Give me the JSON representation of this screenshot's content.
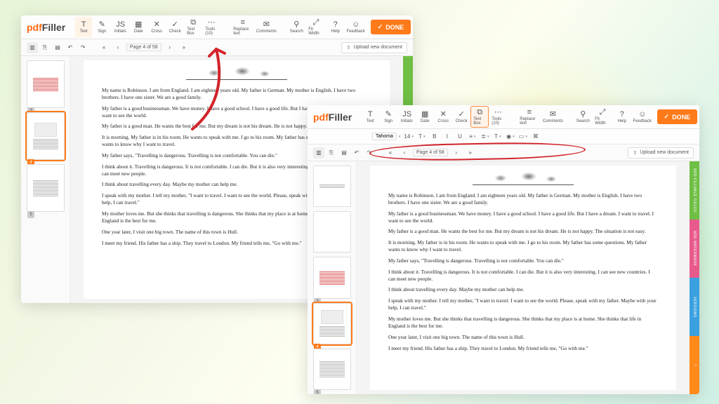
{
  "brand": {
    "pdf": "pdf",
    "filler": "Filler"
  },
  "done_label": "DONE",
  "upload_label": "Upload new document",
  "page_indicator": "Page 4 of 58",
  "second_page_indicator": "Page 4 of 58",
  "toolbar": [
    {
      "id": "text",
      "label": "Text",
      "glyph": "T"
    },
    {
      "id": "sign",
      "label": "Sign",
      "glyph": "✎"
    },
    {
      "id": "initials",
      "label": "Initials",
      "glyph": "JS"
    },
    {
      "id": "date",
      "label": "Date",
      "glyph": "▦"
    },
    {
      "id": "cross",
      "label": "Cross",
      "glyph": "✕"
    },
    {
      "id": "check",
      "label": "Check",
      "glyph": "✓"
    },
    {
      "id": "textbox",
      "label": "Text Box",
      "glyph": "⧉"
    },
    {
      "id": "tools",
      "label": "Tools (10)",
      "glyph": "⋯"
    }
  ],
  "toolbar_mid": [
    {
      "id": "replace",
      "label": "Replace text",
      "glyph": "≡"
    },
    {
      "id": "comments",
      "label": "Comments",
      "glyph": "✉"
    }
  ],
  "toolbar_right": [
    {
      "id": "search",
      "label": "Search",
      "glyph": "⚲"
    },
    {
      "id": "fitwidth",
      "label": "Fit Width",
      "glyph": "⤢"
    },
    {
      "id": "help",
      "label": "Help",
      "glyph": "?"
    },
    {
      "id": "feedback",
      "label": "Feedback",
      "glyph": "☺"
    }
  ],
  "second_quick": [
    {
      "id": "sheet",
      "glyph": "▥"
    },
    {
      "id": "copy",
      "glyph": "⎘"
    },
    {
      "id": "pages",
      "glyph": "▤"
    },
    {
      "id": "undo",
      "glyph": "↶"
    },
    {
      "id": "redo",
      "glyph": "↷"
    }
  ],
  "format_bar": {
    "font_name": "Tahoma",
    "font_size": "14",
    "items": [
      {
        "id": "fontsize",
        "glyph": "14",
        "drop": true
      },
      {
        "id": "lineheight",
        "glyph": "T",
        "drop": true
      },
      {
        "id": "bold",
        "glyph": "B"
      },
      {
        "id": "italic",
        "glyph": "I"
      },
      {
        "id": "underline",
        "glyph": "U"
      },
      {
        "id": "align",
        "glyph": "≡",
        "drop": true
      },
      {
        "id": "bullets",
        "glyph": "≣",
        "drop": true
      },
      {
        "id": "case",
        "glyph": "T",
        "drop": true
      },
      {
        "id": "color",
        "glyph": "◉",
        "drop": true
      },
      {
        "id": "bg",
        "glyph": "▭",
        "drop": true
      },
      {
        "id": "link",
        "glyph": "⌘"
      }
    ]
  },
  "siderails": {
    "green": "ADD FILLABLE FIELDS",
    "pink": "ADD WATERMARK",
    "blue": "VERSIONS",
    "orange": "?"
  },
  "doc_paragraphs": [
    "My name is Robinson. I am from England. I am eighteen years old. My father is German. My mother is English. I have two brothers. I have one sister. We are a good family.",
    "My father is a good businessman. We have money. I have a good school. I have a good life. But I have a dream. I want to travel. I want to see the world.",
    "My father is a good man. He wants the best for me. But my dream is not his dream. He is not happy. The situation is not easy.",
    "It is morning. My father is in his room. He wants to speak with me. I go to his room. My father has some questions. My father wants to know why I want to travel.",
    "My father says, \"Travelling is dangerous. Travelling is not comfortable. You can die.\"",
    "I think about it. Travelling is dangerous. It is not comfortable. I can die. But it is also very interesting. I can see new countries. I can meet new people.",
    "I think about travelling every day. Maybe my mother can help me.",
    "I speak with my mother. I tell my mother, \"I want to travel. I want to see the world. Please, speak with my father. Maybe with your help, I can travel.\"",
    "My mother loves me. But she thinks that travelling is dangerous. She thinks that my place is at home. She thinks that life in England is the best for me.",
    "One year later, I visit one big town. The name of this town is Hull.",
    "I meet my friend. His father has a ship. They travel to London. My friend tells me, \"Go with me.\""
  ],
  "doc_paragraphs_a": [
    "My name is Robinson. I am from England. I am eighteen years old. My father is German. My mother is English. I have two brothers. I have one sister. We are a good family.",
    "My father is a good businessman. We have money. I have a good school. I have a good life. But I have a dream. I want to travel. I want to see the world.",
    "My father is a good man. He wants the best for me. But my dream is not his dream. He is not happy. The situation is not easy.",
    "It is morning. My father is in his room. He wants to speak with me. I go to his room. My father has some questions. My father wants to know why I want to travel.",
    "My father says, \"Travelling is dangerous. Travelling is not comfortable. You can die.\"",
    "I think about it. Travelling is dangerous. It is not comfortable. I can die. But it is also very interesting. I can see new countries. I can meet new people.",
    "I think about travelling every day. Maybe my mother can help me.",
    "I speak with my mother. I tell my mother, \"I want to travel. I want to see the world. Please, speak with my father. Maybe with your help, I can travel.\"",
    "My mother loves me. But she thinks that travelling is dangerous. She thinks that my place is at home. She thinks that life in England is the best for me.",
    "One year later, I visit one big town. The name of this town is Hull.",
    "I meet my friend. His father has a ship. They travel to London. My friend tells me, \"Go with me.\""
  ],
  "thumbs": [
    {
      "n": "3",
      "sel": false,
      "style": "red"
    },
    {
      "n": "4",
      "sel": true,
      "style": "img"
    },
    {
      "n": "5",
      "sel": false,
      "style": "grey"
    }
  ],
  "thumbs_b_pre": [
    {
      "n": "",
      "sel": false,
      "style": "title"
    },
    {
      "n": "",
      "sel": false,
      "style": "blank"
    }
  ]
}
